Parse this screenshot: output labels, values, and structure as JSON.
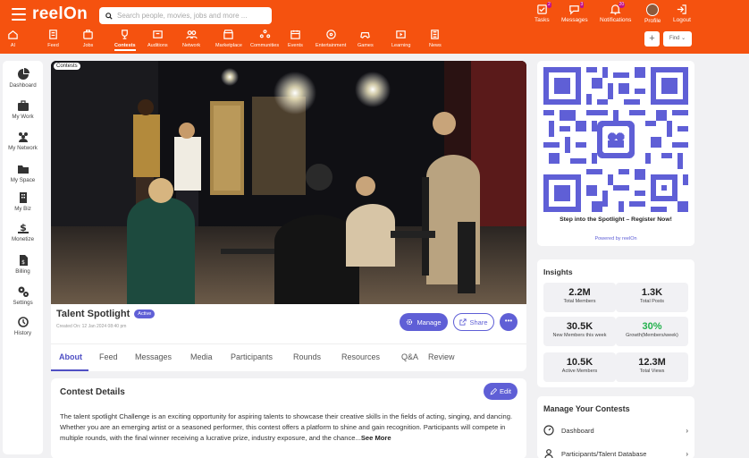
{
  "app": {
    "logo": "reelOn",
    "search_placeholder": "Search people, movies, jobs and more ...",
    "brand_color": "#f5520f",
    "accent_color": "#5f5fd6"
  },
  "nav": [
    {
      "label": "AI",
      "icon": "home-icon"
    },
    {
      "label": "Feed",
      "icon": "feed-icon"
    },
    {
      "label": "Jobs",
      "icon": "briefcase-icon"
    },
    {
      "label": "Contests",
      "icon": "trophy-icon",
      "active": true
    },
    {
      "label": "Auditions",
      "icon": "auditions-icon"
    },
    {
      "label": "Network",
      "icon": "network-icon"
    },
    {
      "label": "Marketplace",
      "icon": "store-icon"
    },
    {
      "label": "Communities",
      "icon": "communities-icon"
    },
    {
      "label": "Events",
      "icon": "calendar-icon"
    },
    {
      "label": "Entertainment",
      "icon": "film-reel-icon"
    },
    {
      "label": "Games",
      "icon": "gamepad-icon"
    },
    {
      "label": "Learning",
      "icon": "play-icon"
    },
    {
      "label": "News",
      "icon": "newspaper-icon"
    }
  ],
  "top_right": {
    "tasks": {
      "label": "Tasks",
      "count": "2"
    },
    "messages": {
      "label": "Messages",
      "count": "3"
    },
    "notifications": {
      "label": "Notifications",
      "count": "20"
    },
    "profile": {
      "label": "Profile"
    },
    "logout": {
      "label": "Logout"
    },
    "plus": "+",
    "find": "Find ⌄"
  },
  "sidebar": [
    {
      "label": "Dashboard",
      "icon": "pie-chart-icon"
    },
    {
      "label": "My Work",
      "icon": "briefcase-icon"
    },
    {
      "label": "My Network",
      "icon": "people-icon"
    },
    {
      "label": "My Space",
      "icon": "folder-icon"
    },
    {
      "label": "My Biz",
      "icon": "building-icon"
    },
    {
      "label": "Monetize",
      "icon": "dollar-icon"
    },
    {
      "label": "Billing",
      "icon": "invoice-icon"
    },
    {
      "label": "Settings",
      "icon": "gears-icon"
    },
    {
      "label": "History",
      "icon": "history-icon"
    }
  ],
  "contest": {
    "tag": "Contests",
    "title": "Talent Spotlight",
    "status": "Active",
    "created": "Created On: 12 Jan 2024 08:40 pm",
    "manage": "Manage",
    "share": "Share",
    "more": "•••",
    "tabs": [
      "About",
      "Feed",
      "Messages",
      "Media",
      "Participants",
      "Rounds",
      "Resources",
      "Q&A",
      "Review"
    ],
    "details_title": "Contest Details",
    "edit": "Edit",
    "description": "The talent spotlight Challenge is an exciting opportunity for aspiring talents to showcase their creative skills in the fields of acting, singing, and dancing. Whether you are an emerging artist or a seasoned performer, this contest offers a platform to shine and gain recognition. Participants will compete in multiple rounds, with the final winner receiving a lucrative prize, industry exposure, and the chance...",
    "see_more": "See More"
  },
  "qr": {
    "tagline": "Step into the Spotlight – Register Now!",
    "powered": "Powered by reelOn"
  },
  "insights": {
    "title": "Insights",
    "stats": [
      {
        "value": "2.2M",
        "label": "Total Members"
      },
      {
        "value": "1.3K",
        "label": "Total Posts"
      },
      {
        "value": "30.5K",
        "label": "New Members this week"
      },
      {
        "value": "30%",
        "label": "Growth(Members/week)"
      },
      {
        "value": "10.5K",
        "label": "Active Members"
      },
      {
        "value": "12.3M",
        "label": "Total Views"
      }
    ]
  },
  "manage": {
    "title": "Manage Your Contests",
    "items": [
      {
        "label": "Dashboard",
        "icon": "dashboard-gauge-icon"
      },
      {
        "label": "Participants/Talent Database",
        "icon": "person-icon"
      }
    ]
  }
}
